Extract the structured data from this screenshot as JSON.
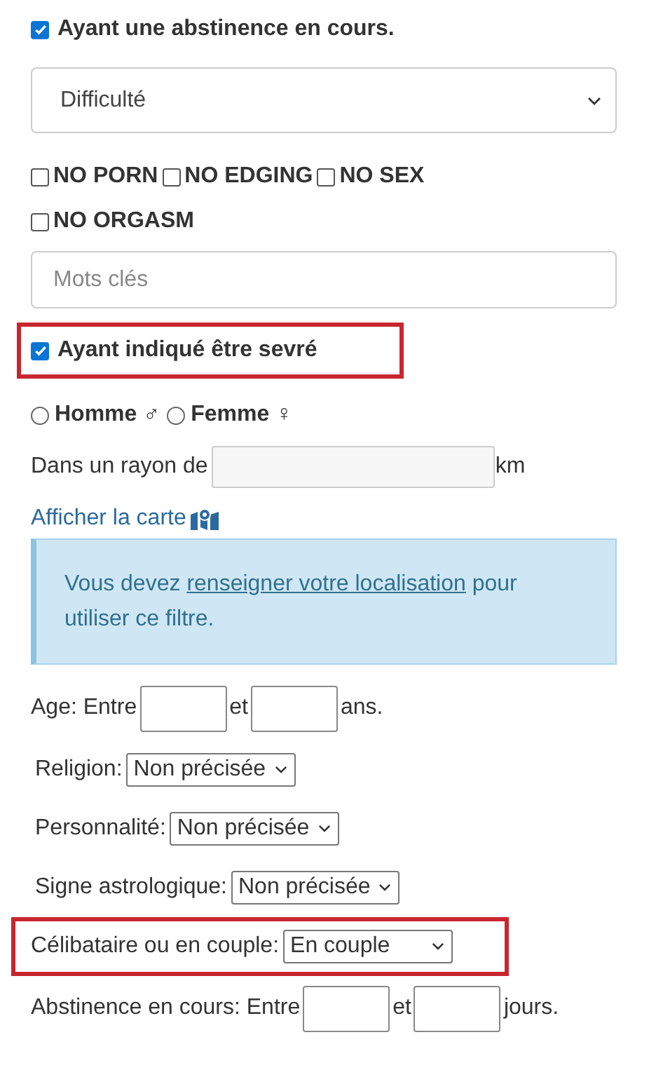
{
  "abstinence_filter": {
    "label": "Ayant une abstinence en cours.",
    "checked": true
  },
  "difficulty_select": {
    "value": "Difficulté"
  },
  "challenges": [
    {
      "label": "NO PORN",
      "checked": false
    },
    {
      "label": "NO EDGING",
      "checked": false
    },
    {
      "label": "NO SEX",
      "checked": false
    },
    {
      "label": "NO ORGASM",
      "checked": false
    }
  ],
  "keywords_field": {
    "placeholder": "Mots clés"
  },
  "weaned_filter": {
    "label": "Ayant indiqué être sevré",
    "checked": true,
    "highlighted": true
  },
  "gender": [
    {
      "label": "Homme ♂",
      "selected": false
    },
    {
      "label": "Femme ♀",
      "selected": false
    }
  ],
  "radius": {
    "label": "Dans un rayon de",
    "unit": "km"
  },
  "map_link": {
    "label": "Afficher la carte"
  },
  "alert": {
    "text_before": "Vous devez",
    "link": "renseigner votre localisation",
    "text_after": "pour utiliser ce filtre."
  },
  "age": {
    "label": "Age: Entre",
    "between": "et",
    "unit": "ans."
  },
  "selects": [
    {
      "label": "Religion:",
      "value": "Non précisée",
      "highlighted": false
    },
    {
      "label": "Personnalité:",
      "value": "Non précisée",
      "highlighted": false
    },
    {
      "label": "Signe astrologique:",
      "value": "Non précisée",
      "highlighted": false
    },
    {
      "label": "Célibataire ou en couple:",
      "value": "En couple",
      "highlighted": true
    }
  ],
  "abstinence_range": {
    "label": "Abstinence en cours: Entre",
    "between": "et",
    "unit": "jours."
  }
}
